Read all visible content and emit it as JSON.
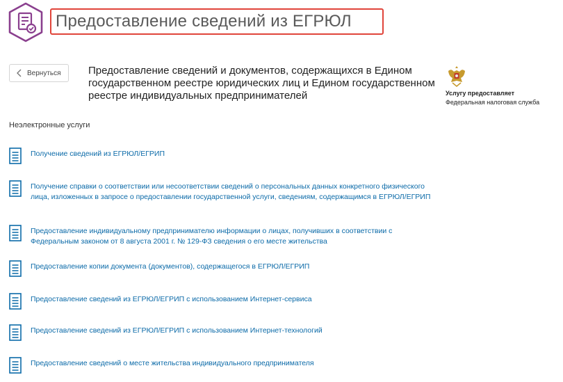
{
  "header": {
    "title": "Предоставление сведений из ЕГРЮЛ",
    "icon": "hexagon-document-check-icon",
    "accent_color": "#8a3f8e",
    "highlight_color": "#e0443a"
  },
  "back_button": {
    "label": "Вернуться",
    "icon": "chevron-left-icon"
  },
  "service": {
    "heading": "Предоставление сведений и документов, содержащихся в Едином государственном реестре юридических лиц и Едином государственном реестре индивидуальных предпринимателей",
    "provider_label": "Услугу предоставляет",
    "provider_name": "Федеральная налоговая служба",
    "emblem": "russian-coat-of-arms-icon"
  },
  "section": {
    "label": "Неэлектронные услуги"
  },
  "items": [
    {
      "label": "Получение сведений из ЕГРЮЛ/ЕГРИП"
    },
    {
      "label": "Получение справки о соответствии или несоответствии сведений о персональных данных конкретного физического лица, изложенных в запросе о предоставлении государственной услуги, сведениям, содержащимся в ЕГРЮЛ/ЕГРИП"
    },
    {
      "label": "Предоставление индивидуальному предпринимателю информации о лицах, получивших в соответствии с Федеральным законом от 8 августа 2001 г. № 129-ФЗ сведения о его месте жительства"
    },
    {
      "label": "Предоставление копии документа (документов), содержащегося в ЕГРЮЛ/ЕГРИП"
    },
    {
      "label": "Предоставление сведений из ЕГРЮЛ/ЕГРИП с использованием Интернет-сервиса"
    },
    {
      "label": "Предоставление сведений из ЕГРЮЛ/ЕГРИП с использованием Интернет-технологий"
    },
    {
      "label": "Предоставление сведений о месте жительства индивидуального предпринимателя"
    }
  ],
  "link_color": "#0b6aa8"
}
